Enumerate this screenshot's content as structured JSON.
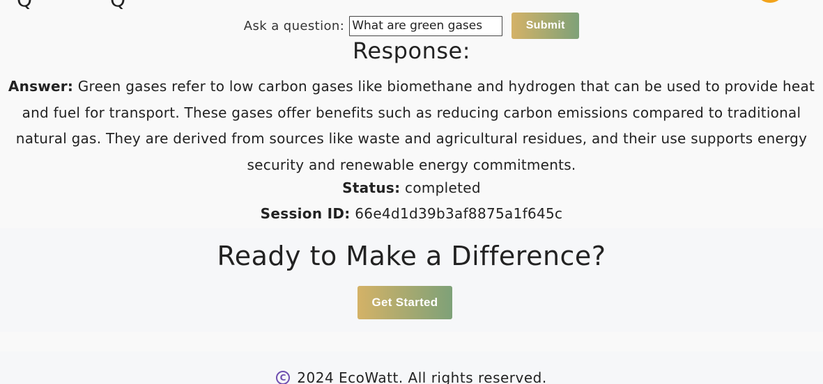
{
  "top": {
    "glyph_left": "Q",
    "glyph_right": "Q",
    "accent_color": "#f2a31b"
  },
  "ask": {
    "label": "Ask a question:",
    "input_value": "What are green gases",
    "submit_label": "Submit"
  },
  "response": {
    "title": "Response:",
    "answer_label": "Answer:",
    "answer_text": "Green gases refer to low carbon gases like biomethane and hydrogen that can be used to provide heat and fuel for transport. These gases offer benefits such as reducing carbon emissions compared to traditional natural gas. They are derived from sources like waste and agricultural residues, and their use supports energy security and renewable energy commitments.",
    "status_label": "Status:",
    "status_value": "completed",
    "session_label": "Session ID:",
    "session_value": "66e4d1d39b3af8875a1f645c"
  },
  "cta": {
    "title": "Ready to Make a Difference?",
    "button_label": "Get Started"
  },
  "footer": {
    "copyright_icon": "copyright-icon",
    "text": "2024 EcoWatt. All rights reserved."
  },
  "colors": {
    "button_gradient_start": "#d4b267",
    "button_gradient_end": "#7ea178",
    "copyright_icon": "#6f4fb0"
  }
}
